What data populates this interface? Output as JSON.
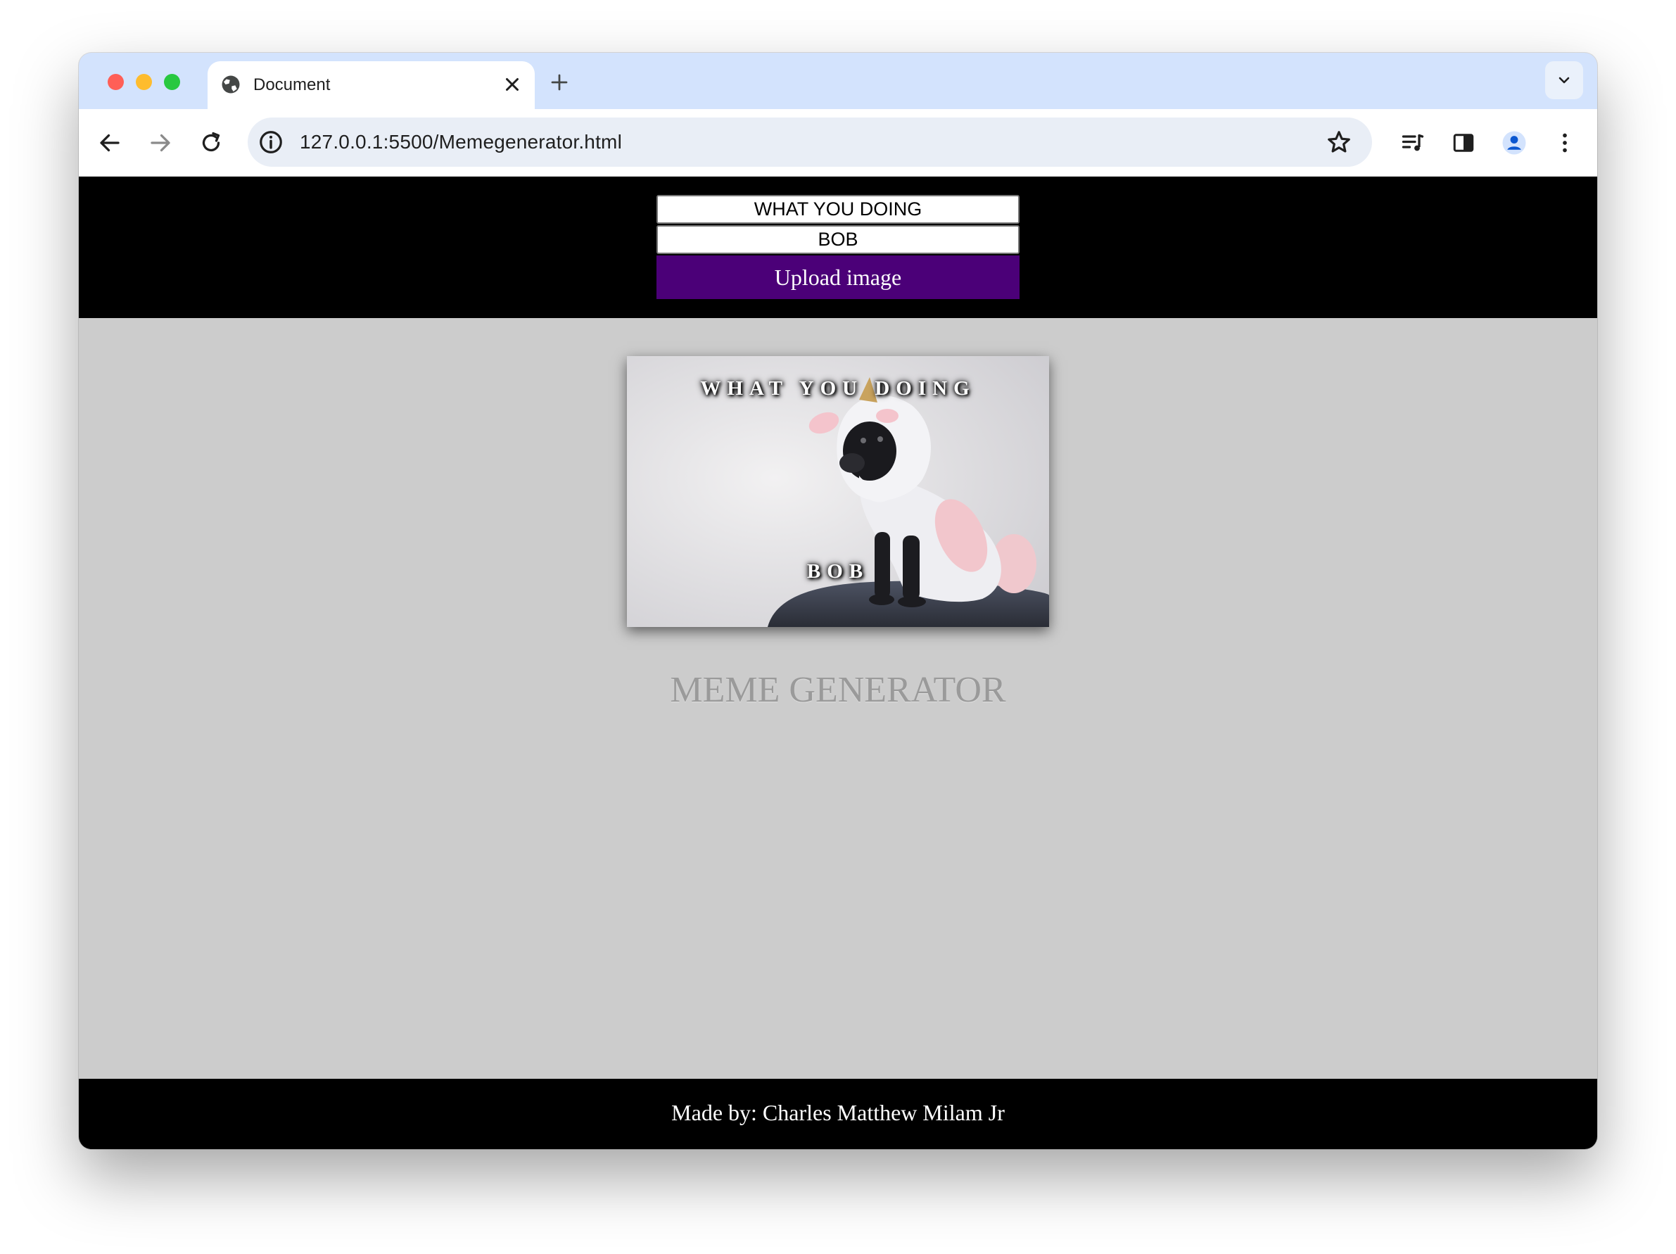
{
  "browser": {
    "tab_title": "Document",
    "url": "127.0.0.1:5500/Memegenerator.html"
  },
  "form": {
    "top_text_value": "WHAT YOU DOING",
    "bottom_text_value": "BOB",
    "upload_label": "Upload image"
  },
  "meme": {
    "top_caption": "WHAT YOU DOING",
    "bottom_caption": "BOB"
  },
  "page": {
    "title": "MEME GENERATOR",
    "footer": "Made by: Charles Matthew Milam Jr"
  },
  "colors": {
    "header_bg": "#000000",
    "upload_button": "#4b0078",
    "page_bg": "#cccccc",
    "title_text": "#9a9a9a"
  },
  "icons": [
    "globe-icon",
    "close-icon",
    "plus-icon",
    "chevron-down-icon",
    "back-arrow-icon",
    "forward-arrow-icon",
    "reload-icon",
    "info-icon",
    "star-icon",
    "media-controls-icon",
    "side-panel-icon",
    "profile-icon",
    "more-vert-icon"
  ]
}
